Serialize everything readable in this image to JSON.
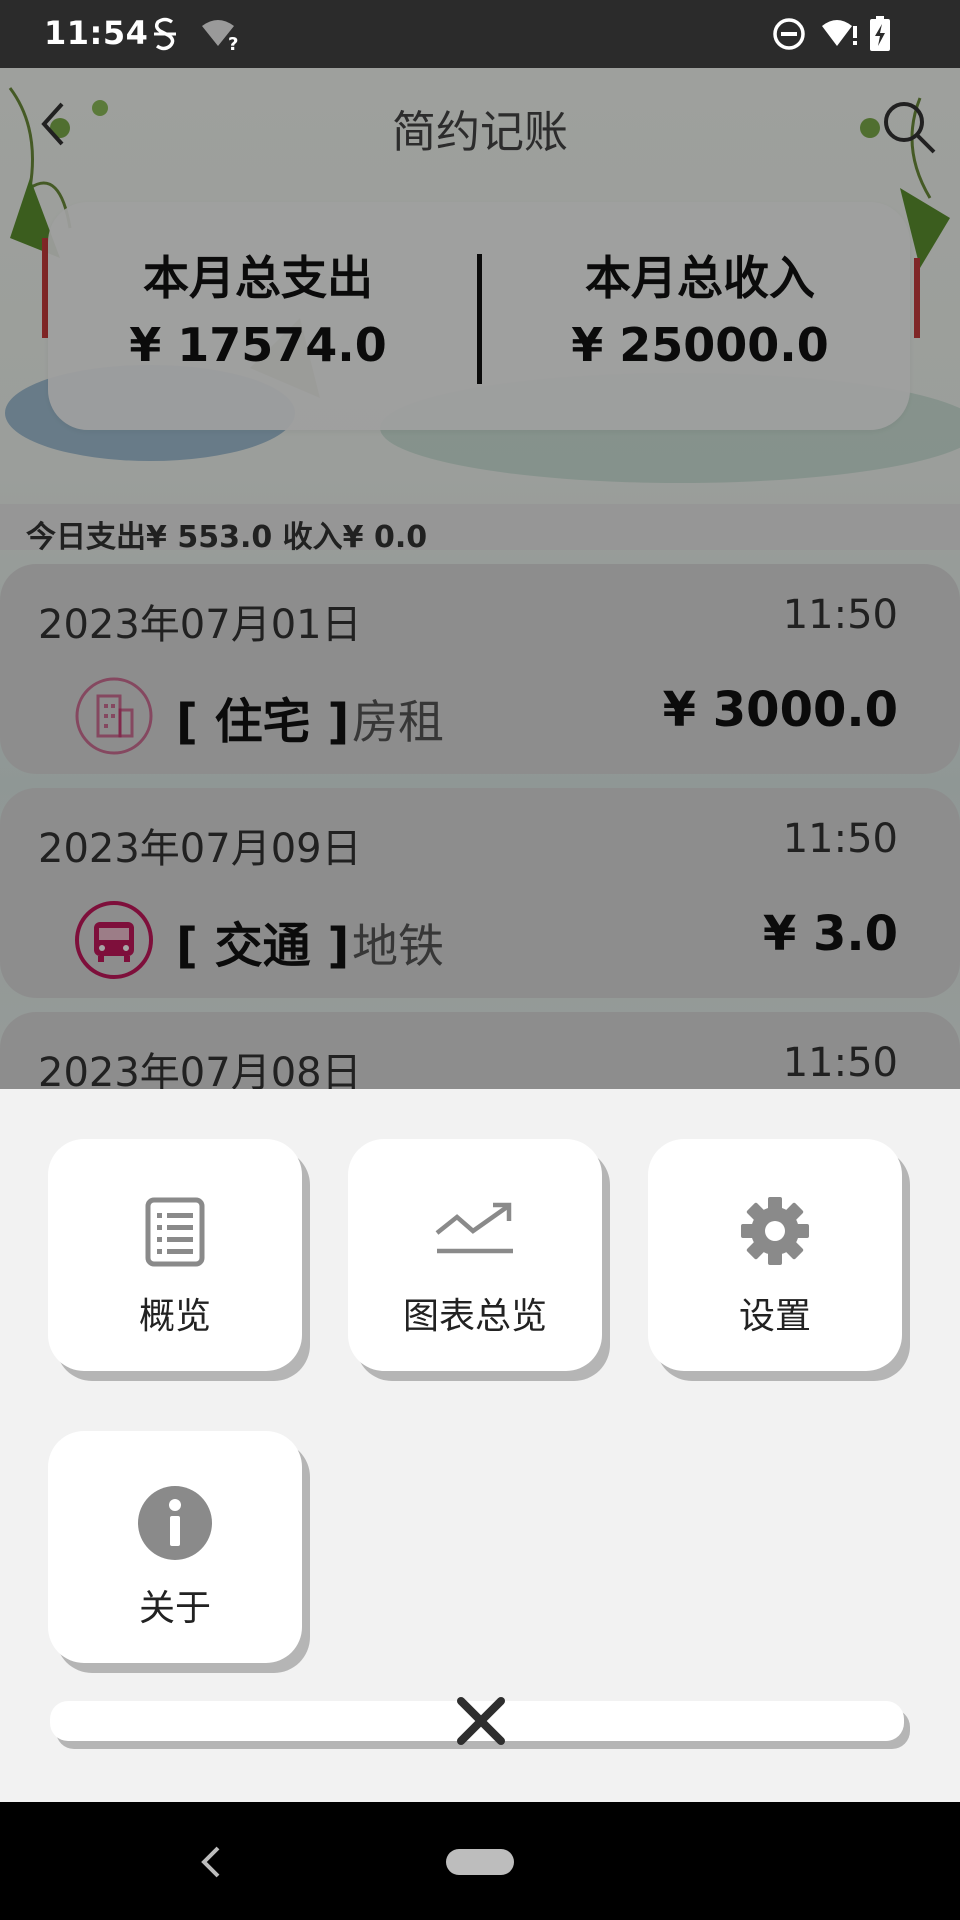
{
  "status_bar": {
    "time": "11:54"
  },
  "app": {
    "title": "简约记账",
    "summary": {
      "expense_label": "本月总支出",
      "expense_value": "¥ 17574.0",
      "income_label": "本月总收入",
      "income_value": "¥ 25000.0"
    },
    "today": "今日支出¥ 553.0 收入¥ 0.0",
    "records": [
      {
        "date": "2023年07月01日",
        "time": "11:50",
        "category": "[ 住宅 ]",
        "note": "房租",
        "amount": "¥ 3000.0",
        "icon": "building-icon"
      },
      {
        "date": "2023年07月09日",
        "time": "11:50",
        "category": "[ 交通 ]",
        "note": "地铁",
        "amount": "¥ 3.0",
        "icon": "bus-icon"
      },
      {
        "date": "2023年07月08日",
        "time": "11:50"
      }
    ]
  },
  "menu": {
    "overview": "概览",
    "charts": "图表总览",
    "settings": "设置",
    "about": "关于"
  },
  "colors": {
    "accent_pink": "#c2185b",
    "sheet_bg": "#f2f2f2",
    "tile_shadow": "#b5b5b5",
    "icon_gray": "#8a8a8a"
  }
}
